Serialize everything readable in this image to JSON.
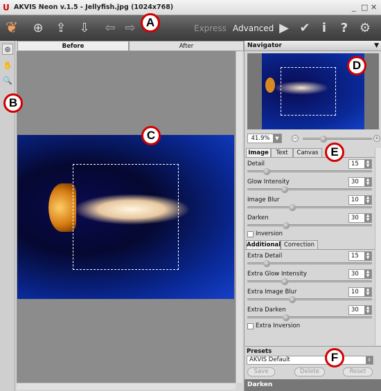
{
  "window": {
    "title": "AKVIS Neon v.1.5 - Jellyfish.jpg (1024x768)",
    "minimize": "_",
    "maximize": "□",
    "close": "✕"
  },
  "toolbar": {
    "express_label": "Express",
    "advanced_label": "Advanced"
  },
  "canvas_tabs": {
    "before": "Before",
    "after": "After"
  },
  "navigator": {
    "title": "Navigator",
    "zoom": "41.9%"
  },
  "settings": {
    "tabs": [
      "Image",
      "Text",
      "Canvas"
    ],
    "params": [
      {
        "label": "Detail",
        "value": "15",
        "pct": 15
      },
      {
        "label": "Glow Intensity",
        "value": "30",
        "pct": 30
      },
      {
        "label": "Image Blur",
        "value": "10",
        "pct": 36
      },
      {
        "label": "Darken",
        "value": "30",
        "pct": 31
      }
    ],
    "inversion": "Inversion",
    "sub_tabs": [
      "Additional",
      "Correction"
    ],
    "extra_params": [
      {
        "label": "Extra Detail",
        "value": "15",
        "pct": 15
      },
      {
        "label": "Extra Glow Intensity",
        "value": "30",
        "pct": 30
      },
      {
        "label": "Extra Image Blur",
        "value": "10",
        "pct": 36
      },
      {
        "label": "Extra Darken",
        "value": "30",
        "pct": 31
      }
    ],
    "extra_inversion": "Extra Inversion"
  },
  "presets": {
    "title": "Presets",
    "selected": "AKVIS Default",
    "save": "Save",
    "delete": "Delete",
    "reset": "Reset"
  },
  "hint": {
    "title": "Darken"
  },
  "callouts": {
    "a": "A",
    "b": "B",
    "c": "C",
    "d": "D",
    "e": "E",
    "f": "F"
  }
}
